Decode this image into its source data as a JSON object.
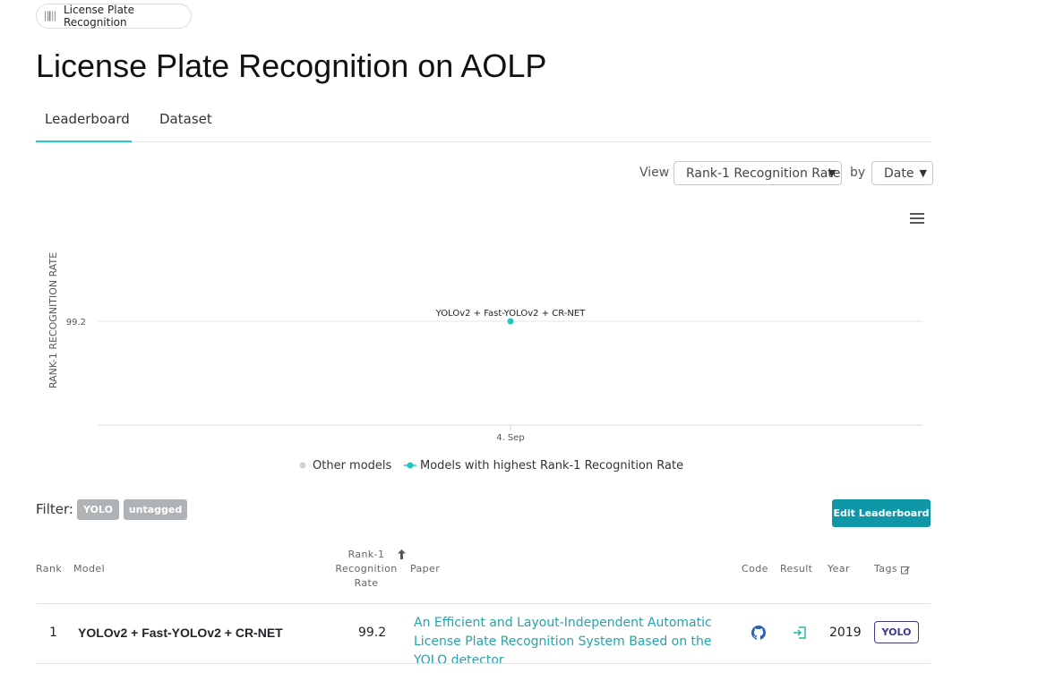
{
  "breadcrumb": {
    "label": "License Plate Recognition"
  },
  "page": {
    "title": "License Plate Recognition on AOLP"
  },
  "tabs": [
    {
      "label": "Leaderboard"
    },
    {
      "label": "Dataset"
    }
  ],
  "view_controls": {
    "view_label": "View",
    "metric_selected": "Rank-1 Recognition Rate",
    "by_label": "by",
    "axis_selected": "Date"
  },
  "chart_data": {
    "type": "scatter",
    "ylabel": "RANK-1 RECOGNITION RATE",
    "yticks": [
      99.2
    ],
    "xticks": [
      "4. Sep"
    ],
    "grid": true,
    "points": [
      {
        "x": "4. Sep",
        "y": 99.2,
        "label": "YOLOv2 + Fast-YOLOv2 + CR-NET",
        "series": "Models with highest Rank-1 Recognition Rate"
      }
    ],
    "legend": {
      "position": "bottom",
      "items": [
        "Other models",
        "Models with highest Rank‑1 Recognition Rate"
      ]
    },
    "colors": {
      "other": "#cfd2d4",
      "highest": "#21c5c5"
    }
  },
  "filter": {
    "label": "Filter:",
    "tags": [
      "YOLO",
      "untagged"
    ]
  },
  "edit_button": {
    "label": "Edit Leaderboard"
  },
  "table": {
    "headers": {
      "rank": "Rank",
      "model": "Model",
      "metric_lines": [
        "Rank-1",
        "Recognition",
        "Rate"
      ],
      "paper": "Paper",
      "code": "Code",
      "result": "Result",
      "year": "Year",
      "tags": "Tags"
    },
    "rows": [
      {
        "rank": "1",
        "model": "YOLOv2 + Fast-YOLOv2 + CR-NET",
        "metric": "99.2",
        "paper": "An Efficient and Layout-Independent Automatic License Plate Recognition System Based on the YOLO detector",
        "year": "2019",
        "tag": "YOLO",
        "code_icon": "github-icon",
        "result_icon": "result-link-icon"
      }
    ]
  }
}
